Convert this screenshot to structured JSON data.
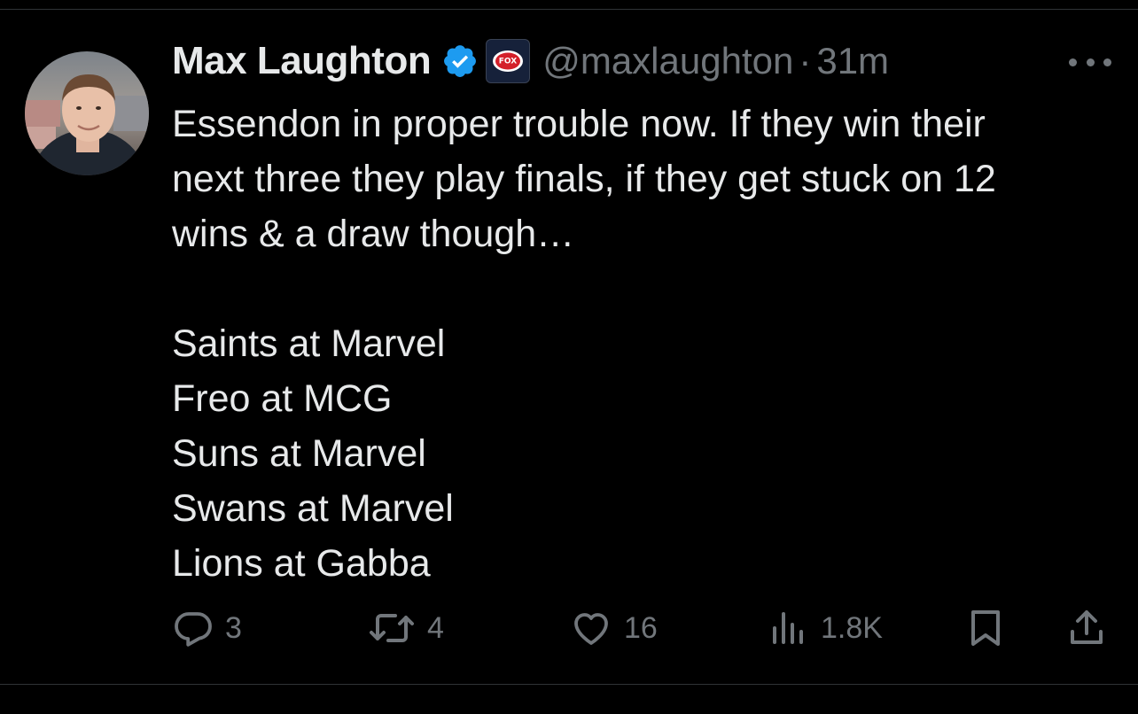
{
  "tweet": {
    "author": {
      "display_name": "Max Laughton",
      "handle": "@maxlaughton",
      "verified": true,
      "affiliation_badge": "FOX"
    },
    "separator": "·",
    "timestamp": "31m",
    "text": "Essendon in proper trouble now. If they win their\nnext three they play finals, if they get stuck on 12\nwins & a draw though…",
    "list": [
      "Saints at Marvel",
      "Freo at MCG",
      "Suns at Marvel",
      "Swans at Marvel",
      "Lions at Gabba"
    ],
    "stats": {
      "replies": "3",
      "reposts": "4",
      "likes": "16",
      "views": "1.8K"
    }
  },
  "icons": {
    "more": "more-horizontal-icon",
    "reply": "reply-icon",
    "repost": "repost-icon",
    "like": "heart-icon",
    "views": "views-icon",
    "bookmark": "bookmark-icon",
    "share": "share-icon"
  },
  "colors": {
    "background": "#000000",
    "text": "#e7e9ea",
    "secondary": "#71767b",
    "verified": "#1d9bf0",
    "divider": "#2f3336"
  }
}
